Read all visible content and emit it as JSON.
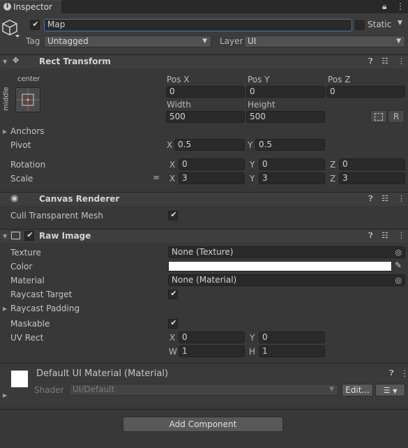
{
  "tab": {
    "label": "Inspector"
  },
  "gameobject": {
    "name": "Map",
    "static_label": "Static",
    "tag_label": "Tag",
    "tag_value": "Untagged",
    "layer_label": "Layer",
    "layer_value": "UI"
  },
  "rect_transform": {
    "title": "Rect Transform",
    "anchor_preset_top": "center",
    "anchor_preset_side": "middle",
    "pos_x_label": "Pos X",
    "pos_x": "0",
    "pos_y_label": "Pos Y",
    "pos_y": "0",
    "pos_z_label": "Pos Z",
    "pos_z": "0",
    "width_label": "Width",
    "width": "500",
    "height_label": "Height",
    "height": "500",
    "r_button": "R",
    "anchors_label": "Anchors",
    "pivot_label": "Pivot",
    "pivot_x_label": "X",
    "pivot_x": "0.5",
    "pivot_y_label": "Y",
    "pivot_y": "0.5",
    "rotation_label": "Rotation",
    "rot_x_label": "X",
    "rot_x": "0",
    "rot_y_label": "Y",
    "rot_y": "0",
    "rot_z_label": "Z",
    "rot_z": "0",
    "scale_label": "Scale",
    "scale_x_label": "X",
    "scale_x": "3",
    "scale_y_label": "Y",
    "scale_y": "3",
    "scale_z_label": "Z",
    "scale_z": "3"
  },
  "canvas_renderer": {
    "title": "Canvas Renderer",
    "cull_label": "Cull Transparent Mesh"
  },
  "raw_image": {
    "title": "Raw Image",
    "texture_label": "Texture",
    "texture_value": "None (Texture)",
    "color_label": "Color",
    "color_value": "#ffffff",
    "material_label": "Material",
    "material_value": "None (Material)",
    "raycast_target_label": "Raycast Target",
    "raycast_padding_label": "Raycast Padding",
    "maskable_label": "Maskable",
    "uv_rect_label": "UV Rect",
    "uv_x_label": "X",
    "uv_x": "0",
    "uv_y_label": "Y",
    "uv_y": "0",
    "uv_w_label": "W",
    "uv_w": "1",
    "uv_h_label": "H",
    "uv_h": "1"
  },
  "material": {
    "title": "Default UI Material (Material)",
    "shader_label": "Shader",
    "shader_value": "UI/Default",
    "edit_button": "Edit..."
  },
  "add_component_button": "Add Component",
  "colors": {
    "background": "#383838",
    "header": "#3e3e3e",
    "field": "#2a2a2a",
    "name_focus": "#3a79bb"
  }
}
